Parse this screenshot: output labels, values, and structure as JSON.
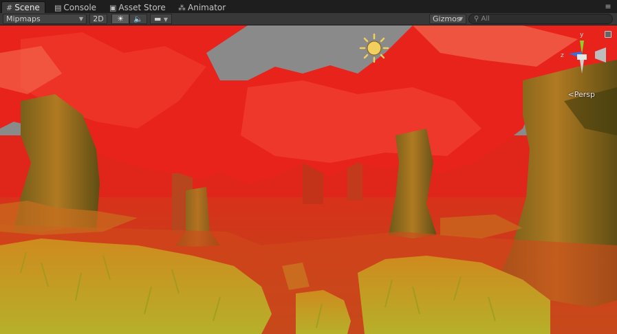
{
  "tabs": [
    {
      "label": "Scene",
      "icon": "grid-icon",
      "active": true
    },
    {
      "label": "Console",
      "icon": "console-icon",
      "active": false
    },
    {
      "label": "Asset Store",
      "icon": "bag-icon",
      "active": false
    },
    {
      "label": "Animator",
      "icon": "animator-icon",
      "active": false
    }
  ],
  "toolbar": {
    "render_mode": "Mipmaps",
    "toggle_2d": "2D",
    "lighting_icon": "sun-icon",
    "audio_icon": "speaker-icon",
    "effects_icon": "image-icon",
    "gizmos_label": "Gizmos",
    "search_placeholder": "All"
  },
  "viewport": {
    "projection_label": "Persp",
    "gizmo_labels": {
      "y": "y",
      "z": "z"
    }
  },
  "colors": {
    "foliage": "#e8231c",
    "trunk": "#9a6a1c",
    "grass": "#c3a822",
    "ground": "#c34014",
    "sky": "#8a8a8a"
  }
}
